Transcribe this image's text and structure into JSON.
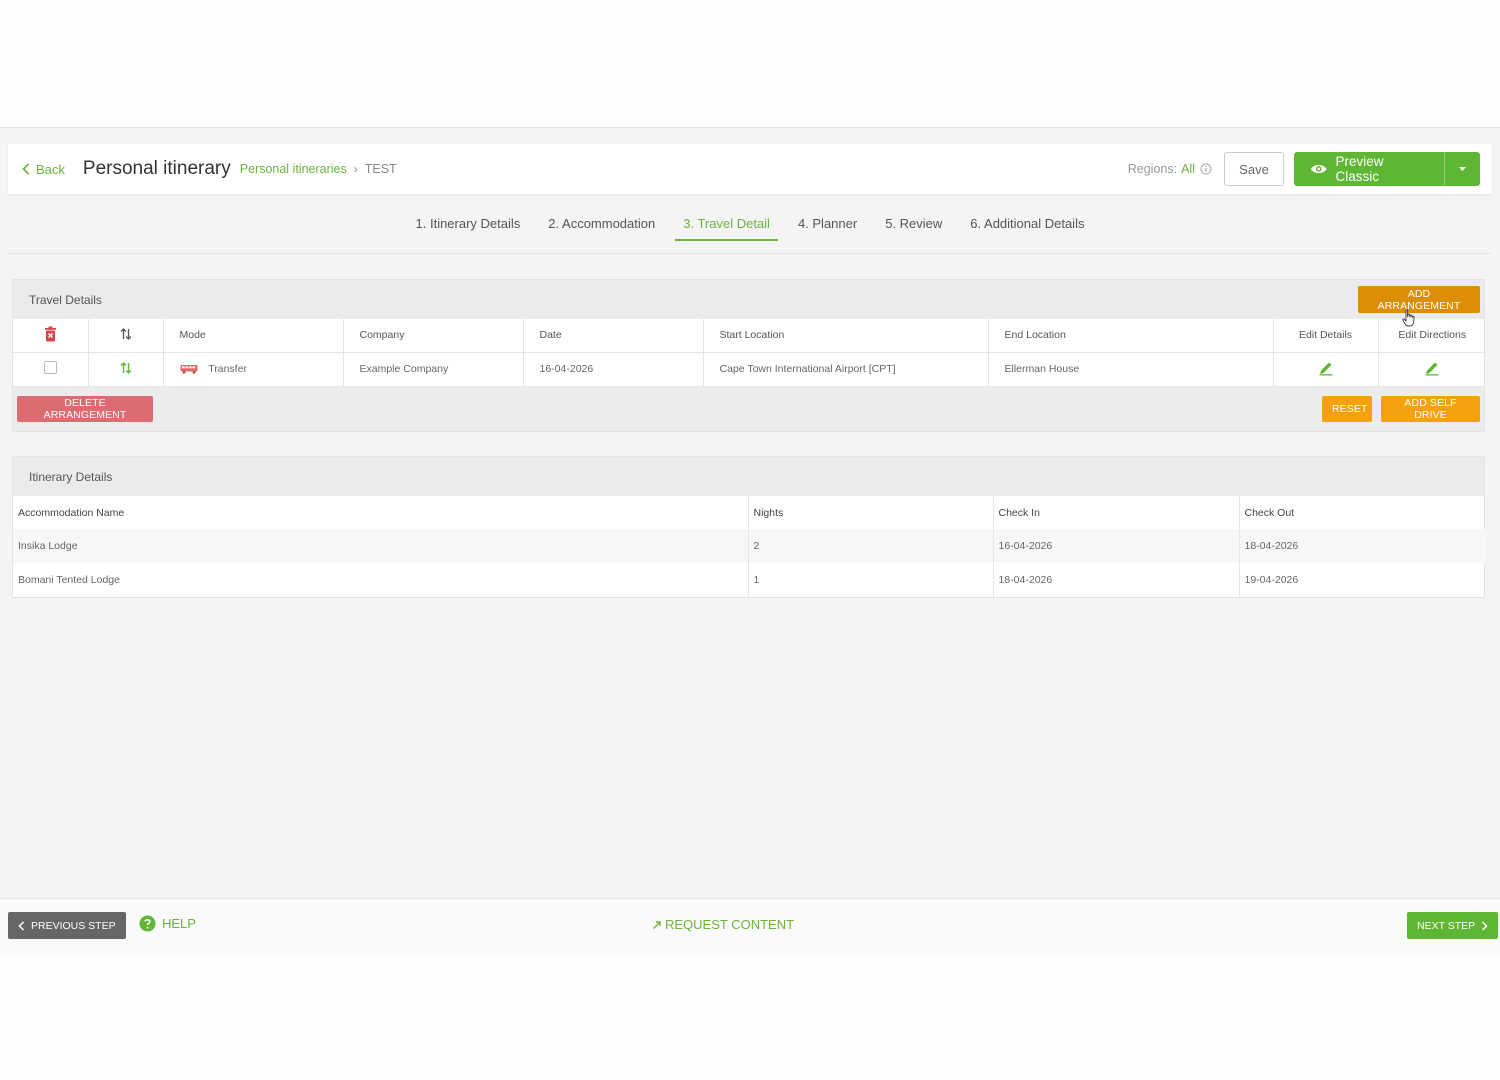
{
  "header": {
    "back_label": "Back",
    "title": "Personal itinerary",
    "breadcrumb_link": "Personal itineraries",
    "breadcrumb_current": "TEST",
    "regions_label": "Regions:",
    "regions_value": "All",
    "save_label": "Save",
    "preview_label": "Preview Classic"
  },
  "tabs": [
    {
      "label": "1. Itinerary Details",
      "active": false
    },
    {
      "label": "2. Accommodation",
      "active": false
    },
    {
      "label": "3. Travel Detail",
      "active": true
    },
    {
      "label": "4. Planner",
      "active": false
    },
    {
      "label": "5. Review",
      "active": false
    },
    {
      "label": "6. Additional Details",
      "active": false
    }
  ],
  "travel": {
    "title": "Travel Details",
    "add_label": "ADD ARRANGEMENT",
    "columns": [
      "Mode",
      "Company",
      "Date",
      "Start Location",
      "End Location",
      "Edit Details",
      "Edit Directions"
    ],
    "rows": [
      {
        "mode": "Transfer",
        "company": "Example Company",
        "date": "16-04-2026",
        "start": "Cape Town International Airport [CPT]",
        "end": "Ellerman House"
      }
    ],
    "delete_label": "DELETE ARRANGEMENT",
    "reset_label": "RESET",
    "self_drive_label": "ADD SELF DRIVE"
  },
  "itinerary": {
    "title": "Itinerary Details",
    "columns": [
      "Accommodation Name",
      "Nights",
      "Check In",
      "Check Out"
    ],
    "rows": [
      {
        "name": "Insika Lodge",
        "nights": "2",
        "check_in": "16-04-2026",
        "check_out": "18-04-2026"
      },
      {
        "name": "Bomani Tented Lodge",
        "nights": "1",
        "check_in": "18-04-2026",
        "check_out": "19-04-2026"
      }
    ]
  },
  "footer": {
    "prev_label": "PREVIOUS STEP",
    "help_label": "HELP",
    "request_label": "REQUEST CONTENT",
    "next_label": "NEXT STEP"
  },
  "colors": {
    "brand_green": "#5fb635",
    "link_green": "#6cb33f",
    "orange": "#f5a00f",
    "dark_orange": "#dc8e06",
    "delete_red": "#dd6b72"
  },
  "icons": [
    "chevron-left-icon",
    "info-icon",
    "eye-icon",
    "caret-down-icon",
    "trash-icon",
    "sort-icon",
    "bus-icon",
    "pencil-icon",
    "help-circle-icon",
    "external-arrow-icon",
    "chevron-right-icon",
    "hand-cursor-icon"
  ]
}
